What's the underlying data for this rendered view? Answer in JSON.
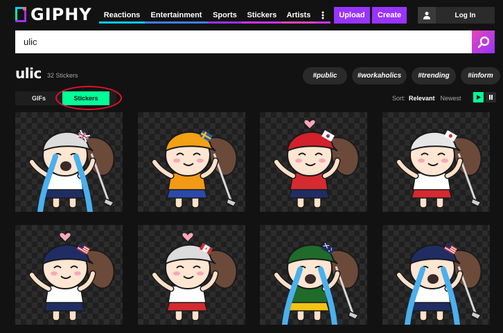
{
  "brand": {
    "name": "GIPHY"
  },
  "nav": {
    "items": [
      {
        "label": "Reactions",
        "color": "#00ccff"
      },
      {
        "label": "Entertainment",
        "color": "#3d7fff"
      },
      {
        "label": "Sports",
        "color": "#9933ff"
      },
      {
        "label": "Stickers",
        "color": "#cc33ff"
      },
      {
        "label": "Artists",
        "color": "#e646b6"
      }
    ],
    "more_icon": "more-vertical-icon",
    "upload_label": "Upload",
    "create_label": "Create",
    "login_label": "Log In"
  },
  "search": {
    "value": "ulic",
    "icon": "search-icon"
  },
  "results": {
    "title": "ulic",
    "count": "32 Stickers",
    "tags": [
      "#public",
      "#workaholics",
      "#trending",
      "#inform"
    ]
  },
  "tabs": {
    "gifs": "GIFs",
    "stickers": "Stickers",
    "active": "stickers"
  },
  "sort": {
    "label": "Sort:",
    "relevant": "Relevant",
    "newest": "Newest",
    "active": "relevant"
  },
  "colors": {
    "accent_green": "#00ff99",
    "accent_purple": "#9933ff",
    "annotation_red": "#e8102a",
    "background": "#121212"
  },
  "stickers": [
    {
      "hat": "#dcdcdc",
      "shirt": "#ffffff",
      "skirt": "#1f2d63",
      "flag": "uk",
      "crying": true,
      "club": true,
      "heart": false
    },
    {
      "hat": "#f2a014",
      "shirt": "#f29a16",
      "skirt": "#2a4aa8",
      "flag": "sweden",
      "crying": false,
      "club": true,
      "heart": false
    },
    {
      "hat": "#d2202c",
      "shirt": "#d42a30",
      "skirt": "#1f2d63",
      "flag": "korea",
      "crying": false,
      "club": false,
      "heart": true
    },
    {
      "hat": "#e6e6e6",
      "shirt": "#ffffff",
      "skirt": "#d42a30",
      "flag": "japan",
      "crying": false,
      "club": true,
      "heart": false
    },
    {
      "hat": "#1f2d63",
      "shirt": "#ffffff",
      "skirt": "#1f2d63",
      "flag": "usa",
      "crying": false,
      "club": false,
      "heart": true
    },
    {
      "hat": "#dcdcdc",
      "shirt": "#ffffff",
      "skirt": "#d42a30",
      "flag": "canada",
      "crying": false,
      "club": false,
      "heart": true
    },
    {
      "hat": "#1f6b2a",
      "shirt": "#1f6b2a",
      "skirt": "#f2c314",
      "flag": "australia",
      "crying": true,
      "club": true,
      "heart": false
    },
    {
      "hat": "#1f2d63",
      "shirt": "#ffffff",
      "skirt": "#1f2d63",
      "flag": "usa",
      "crying": true,
      "club": true,
      "heart": false
    }
  ]
}
